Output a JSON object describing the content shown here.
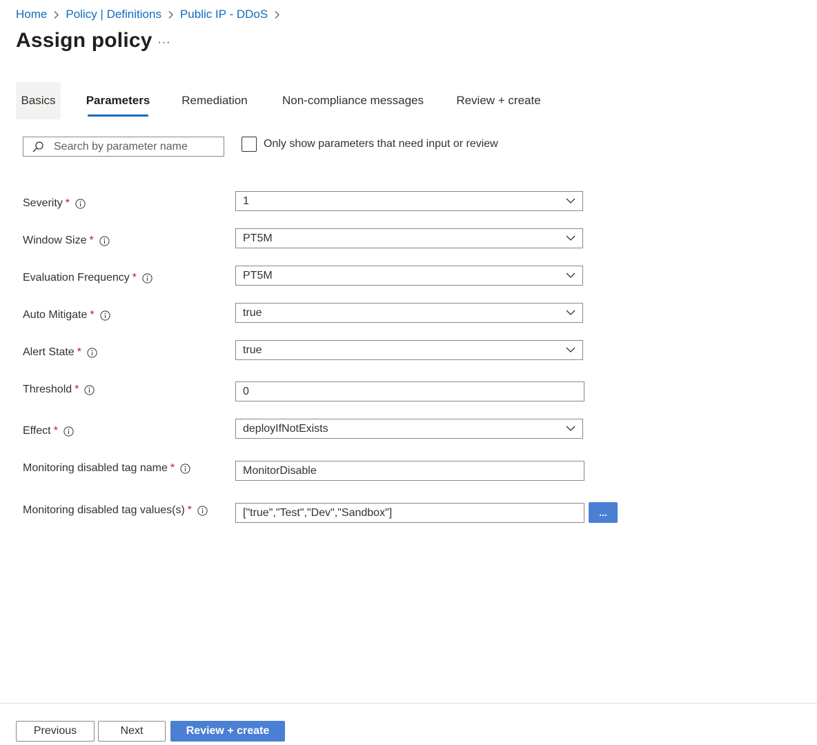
{
  "breadcrumb": [
    "Home",
    "Policy | Definitions",
    "Public IP - DDoS"
  ],
  "page": {
    "title": "Assign policy",
    "more": "···"
  },
  "tabs": [
    {
      "label": "Basics"
    },
    {
      "label": "Parameters"
    },
    {
      "label": "Remediation"
    },
    {
      "label": "Non-compliance messages"
    },
    {
      "label": "Review + create"
    }
  ],
  "filter": {
    "search_placeholder": "Search by parameter name",
    "checkbox_label": "Only show parameters that need input or review"
  },
  "required_mark": "*",
  "params": [
    {
      "label": "Severity",
      "value": "1"
    },
    {
      "label": "Window Size",
      "value": "PT5M"
    },
    {
      "label": "Evaluation Frequency",
      "value": "PT5M"
    },
    {
      "label": "Auto Mitigate",
      "value": "true"
    },
    {
      "label": "Alert State",
      "value": "true"
    },
    {
      "label": "Threshold",
      "value": "0"
    },
    {
      "label": "Effect",
      "value": "deployIfNotExists"
    },
    {
      "label": "Monitoring disabled tag name",
      "value": "MonitorDisable"
    },
    {
      "label": "Monitoring disabled tag values(s)",
      "value": "[\"true\",\"Test\",\"Dev\",\"Sandbox\"]"
    }
  ],
  "ellipsis_button": "...",
  "footer": {
    "previous": "Previous",
    "next": "Next",
    "review": "Review + create"
  },
  "colors": {
    "accent": "#0f6cbd",
    "primary_button": "#4a7fd4",
    "required": "#a4262c"
  },
  "icons": {
    "search": "search-icon",
    "info": "info-icon",
    "dropdown": "chevron-down-icon",
    "breadcrumb_separator": "chevron-right-icon"
  }
}
